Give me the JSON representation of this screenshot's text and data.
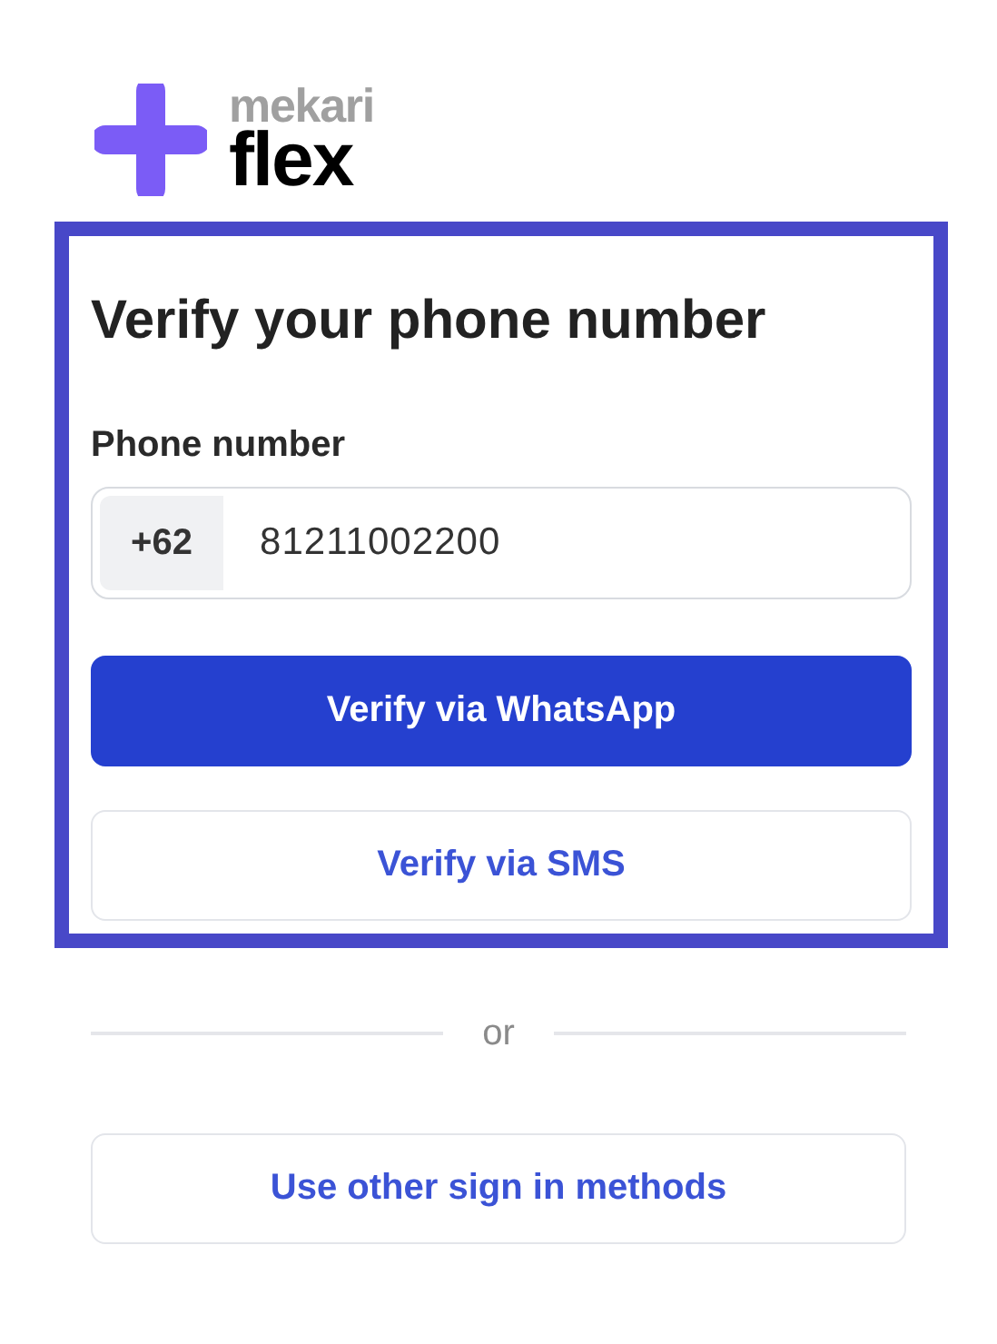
{
  "logo": {
    "brand": "mekari",
    "product": "flex"
  },
  "verify_panel": {
    "title": "Verify your phone number",
    "phone_field": {
      "label": "Phone number",
      "prefix": "+62",
      "value": "81211002200"
    },
    "buttons": [
      {
        "label": "Verify via WhatsApp",
        "kind": "primary"
      },
      {
        "label": "Verify via SMS",
        "kind": "outline"
      }
    ]
  },
  "divider": {
    "label": "or"
  },
  "other_button": {
    "label": "Use other sign in methods",
    "kind": "outline"
  }
}
